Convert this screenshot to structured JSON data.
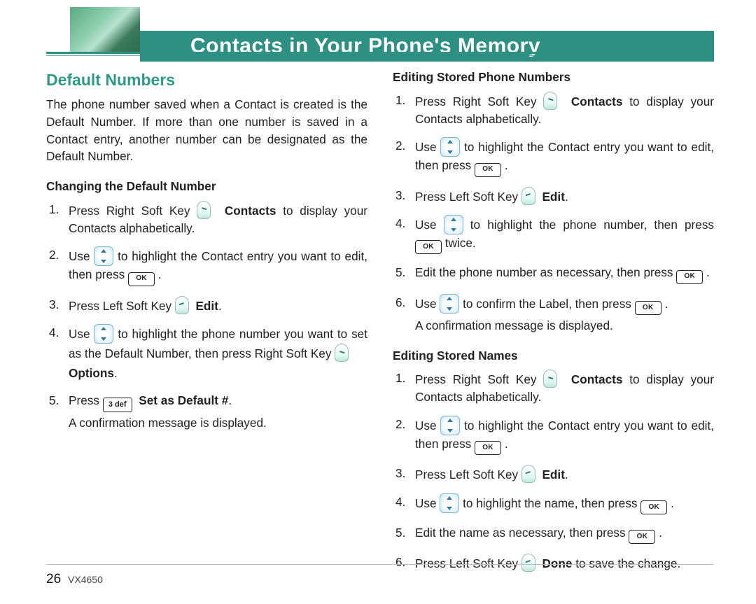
{
  "header": {
    "title": "Contacts in Your Phone's Memory"
  },
  "page": {
    "number": "26",
    "model": "VX4650"
  },
  "key_labels": {
    "ok": "OK",
    "three_def": "3 def"
  },
  "left": {
    "h_green": "Default Numbers",
    "intro": "The phone number saved when a Contact is created is the Default Number. If more than one number is saved in a Contact entry, another number can be designated as the Default Number.",
    "h_black": "Changing the Default Number",
    "steps": [
      {
        "pre": "Press Right Soft Key ",
        "bold": "Contacts",
        "post": " to display your Contacts alphabetically."
      },
      {
        "pre": "Use ",
        "mid": " to highlight the Contact entry you want to edit, then press ",
        "post": " ."
      },
      {
        "pre": "Press Left Soft Key ",
        "bold": "Edit",
        "post": "."
      },
      {
        "pre": "Use ",
        "mid": " to highlight the phone number you want to set as the Default Number, then press Right Soft Key ",
        "bold": "Options",
        "post": "."
      },
      {
        "pre": "Press ",
        "bold": "Set as Default #",
        "post": ".",
        "sub": "A confirmation message is displayed."
      }
    ]
  },
  "right": {
    "h_black_a": "Editing Stored Phone Numbers",
    "steps_a": [
      {
        "pre": "Press Right Soft Key ",
        "bold": "Contacts",
        "post": " to display your Contacts alphabetically."
      },
      {
        "pre": "Use ",
        "mid": " to highlight the Contact entry you want to edit, then press ",
        "post": " ."
      },
      {
        "pre": "Press Left Soft Key ",
        "bold": "Edit",
        "post": "."
      },
      {
        "pre": "Use ",
        "mid": " to highlight the phone number, then press ",
        "post": " twice."
      },
      {
        "pre": "Edit the phone number as necessary, then press ",
        "post": " ."
      },
      {
        "pre": "Use ",
        "mid": " to confirm the Label, then press ",
        "post": " .",
        "sub": "A confirmation message is displayed."
      }
    ],
    "h_black_b": "Editing Stored Names",
    "steps_b": [
      {
        "pre": "Press Right Soft Key ",
        "bold": "Contacts",
        "post": " to display your Contacts alphabetically."
      },
      {
        "pre": "Use ",
        "mid": " to highlight the Contact entry you want to edit, then press ",
        "post": " ."
      },
      {
        "pre": "Press Left Soft Key ",
        "bold": "Edit",
        "post": "."
      },
      {
        "pre": "Use ",
        "mid": " to highlight the name, then press ",
        "post": " ."
      },
      {
        "pre": "Edit the name as necessary, then press ",
        "post": " ."
      },
      {
        "pre": "Press Left Soft Key ",
        "bold": "Done",
        "post": " to save the change."
      }
    ]
  }
}
